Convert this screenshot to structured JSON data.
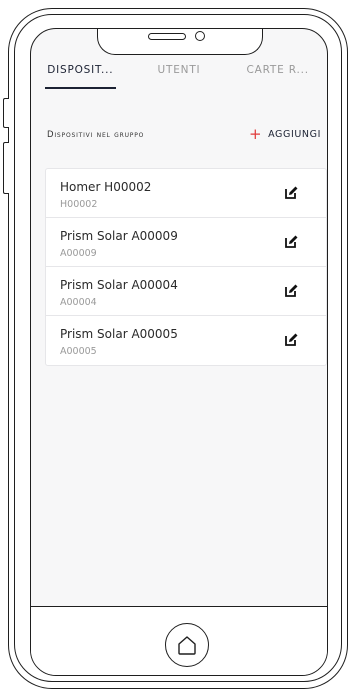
{
  "tabs": [
    {
      "label": "DISPOSIT...",
      "active": true
    },
    {
      "label": "UTENTI",
      "active": false
    },
    {
      "label": "CARTE R...",
      "active": false
    }
  ],
  "section": {
    "title": "Dispositivi nel gruppo",
    "add_label": "AGGIUNGI",
    "add_symbol": "+"
  },
  "devices": [
    {
      "name": "Homer H00002",
      "code": "H00002",
      "icon": "edit-icon"
    },
    {
      "name": "Prism Solar A00009",
      "code": "A00009",
      "icon": "edit-icon"
    },
    {
      "name": "Prism Solar A00004",
      "code": "A00004",
      "icon": "edit-icon"
    },
    {
      "name": "Prism Solar A00005",
      "code": "A00005",
      "icon": "edit-icon"
    }
  ],
  "colors": {
    "accent": "#e03a3a",
    "primary": "#1c2233",
    "muted": "#9a9a9a",
    "background": "#f7f7f8"
  },
  "home_icon": "home-icon"
}
